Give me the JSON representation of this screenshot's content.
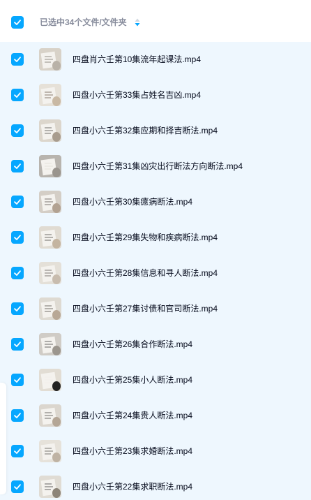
{
  "header": {
    "selected_label": "已选中34个文件/文件夹",
    "sort_icon": "sort-toggle-icon",
    "checked": true
  },
  "accent_color": "#06a7ff",
  "files": [
    {
      "name": "四盘肖六壬第10集流年起课法.mp4",
      "checked": true
    },
    {
      "name": "四盘小六壬第33集占姓名吉凶.mp4",
      "checked": true
    },
    {
      "name": "四盘小六壬第32集应期和择吉断法.mp4",
      "checked": true
    },
    {
      "name": "四盘小六壬第31集凶灾出行断法方向断法.mp4",
      "checked": true
    },
    {
      "name": "四盘小六壬第30集癔病断法.mp4",
      "checked": true
    },
    {
      "name": "四盘小六壬第29集失物和疾病断法.mp4",
      "checked": true
    },
    {
      "name": "四盘小六壬第28集信息和寻人断法.mp4",
      "checked": true
    },
    {
      "name": "四盘小六壬第27集讨债和官司断法.mp4",
      "checked": true
    },
    {
      "name": "四盘小六壬第26集合作断法.mp4",
      "checked": true
    },
    {
      "name": "四盘小六壬第25集小人断法.mp4",
      "checked": true
    },
    {
      "name": "四盘小六壬第24集贵人断法.mp4",
      "checked": true
    },
    {
      "name": "四盘小六壬第23集求婚断法.mp4",
      "checked": true
    },
    {
      "name": "四盘小六壬第22集求职断法.mp4",
      "checked": true
    }
  ]
}
